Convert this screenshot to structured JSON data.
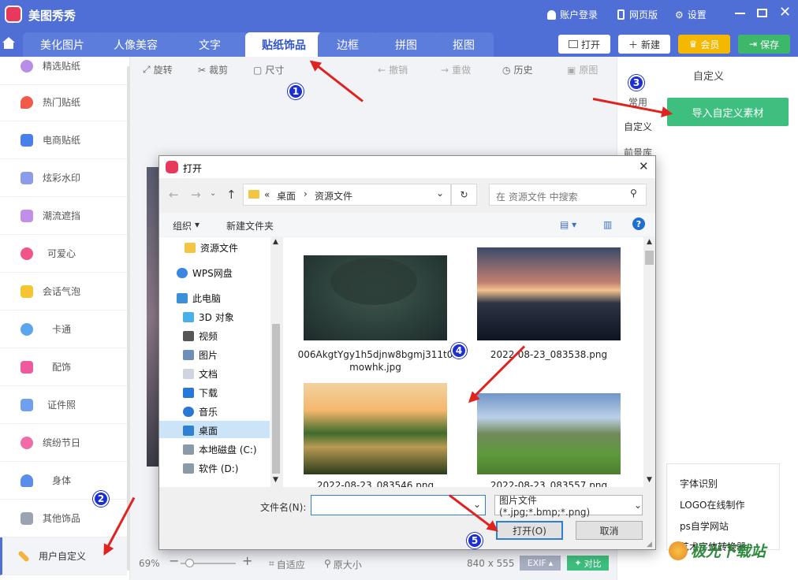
{
  "app": {
    "title": "美图秀秀",
    "account": "账户登录",
    "web": "网页版",
    "settings": "设置"
  },
  "tabs": [
    "美化图片",
    "人像美容",
    "文字",
    "贴纸饰品",
    "边框",
    "拼图",
    "抠图"
  ],
  "top_buttons": {
    "open": "打开",
    "new": "新建",
    "vip": "会员",
    "save": "保存"
  },
  "sidebar": [
    "精选贴纸",
    "热门贴纸",
    "电商贴纸",
    "炫彩水印",
    "潮流遮挡",
    "可爱心",
    "会话气泡",
    "卡通",
    "配饰",
    "证件照",
    "缤纷节日",
    "身体",
    "其他饰品",
    "用户自定义"
  ],
  "toolbar": {
    "rotate": "旋转",
    "crop": "裁剪",
    "size": "尺寸",
    "undo": "撤销",
    "redo": "重做",
    "history": "历史",
    "original": "原图"
  },
  "statusbar": {
    "zoom": "69%",
    "fit": "自适应",
    "actual": "原大小",
    "dims": "840 x 555",
    "exif": "EXIF",
    "compare": "对比"
  },
  "right_panel": {
    "title": "自定义",
    "tabs": [
      "常用",
      "自定义",
      "前景库"
    ],
    "import": "导入自定义素材",
    "links": [
      "字体识别",
      "LOGO在线制作",
      "ps自学网站",
      "艺术字体转换器"
    ]
  },
  "dialog": {
    "title": "打开",
    "path": [
      "桌面",
      "资源文件"
    ],
    "path_prefix": "«",
    "search_placeholder": "在 资源文件 中搜索",
    "organize": "组织",
    "new_folder": "新建文件夹",
    "nav": [
      "资源文件",
      "WPS网盘",
      "此电脑",
      "3D 对象",
      "视频",
      "图片",
      "文档",
      "下载",
      "音乐",
      "桌面",
      "本地磁盘 (C:)",
      "软件 (D:)"
    ],
    "files": [
      "006AkgtYgy1h5djnw8bgmj311t0mowhk.jpg",
      "2022-08-23_083538.png",
      "2022-08-23_083546.png",
      "2022-08-23_083557.png"
    ],
    "filename_label": "文件名(N):",
    "filename_value": "",
    "filetype": "图片文件 (*.jpg;*.bmp;*.png)",
    "open_button": "打开(O)",
    "cancel_button": "取消"
  },
  "badges": [
    "1",
    "2",
    "3",
    "4",
    "5"
  ],
  "watermark": "极光下载站",
  "colors": {
    "brand": "#4f6fd6",
    "accent_green": "#3fbf7f",
    "vip": "#f5b800",
    "save": "#3db86b",
    "arrow": "#e0231e",
    "badge": "#1c2fd0"
  }
}
